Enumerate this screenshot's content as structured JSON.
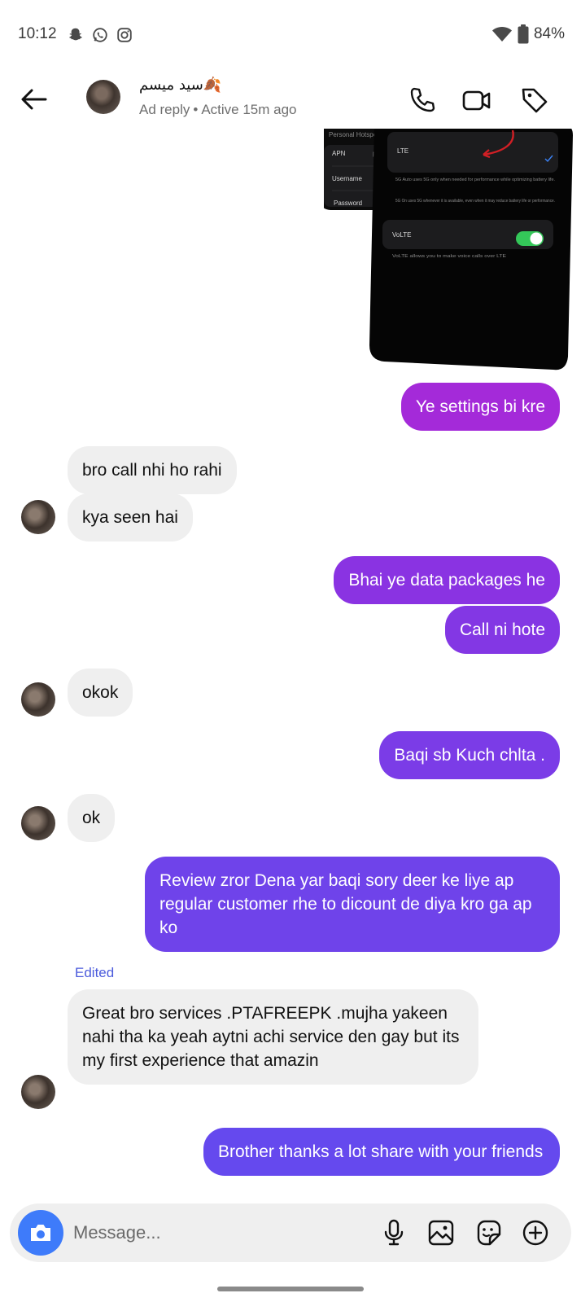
{
  "status_bar": {
    "time": "10:12",
    "battery": "84%",
    "left_icons": [
      "snapchat-icon",
      "whatsapp-icon",
      "instagram-icon"
    ],
    "right_icons": [
      "wifi-icon",
      "battery-icon"
    ]
  },
  "header": {
    "contact_name": "سید میسم🍂",
    "ad_reply": "Ad reply",
    "separator": "•",
    "active_status": "Active 15m ago",
    "icons": [
      "back-arrow-icon",
      "phone-icon",
      "video-icon",
      "tag-icon"
    ]
  },
  "shared_image": {
    "left_card_rows": [
      "Personal Hotspo",
      "APN",
      "Username",
      "Password"
    ],
    "lte_label": "LTE",
    "note_1": "5G Auto uses 5G only when needed for performance while optimizing battery life.",
    "note_2": "5G On uses 5G whenever it is available, even when it may reduce battery life or performance.",
    "volte_label": "VoLTE",
    "volte_note": "VoLTE allows you to make voice calls over LTE"
  },
  "messages": [
    {
      "from": "me",
      "text": "Ye settings bi kre",
      "color": "#a42ad9"
    },
    {
      "from": "them",
      "text": "bro call nhi ho rahi"
    },
    {
      "from": "them",
      "text": "kya seen hai"
    },
    {
      "from": "me",
      "text": "Bhai ye data packages he",
      "color": "#8a33e2"
    },
    {
      "from": "me",
      "text": "Call ni hote",
      "color": "#8337e4"
    },
    {
      "from": "them",
      "text": "okok"
    },
    {
      "from": "me",
      "text": "Baqi sb Kuch chlta .",
      "color": "#7b3ce7"
    },
    {
      "from": "them",
      "text": "ok"
    },
    {
      "from": "me",
      "text": "Review zror Dena yar baqi sory deer ke liye ap regular customer rhe to dicount de diya kro ga ap ko",
      "color": "#6f43ea"
    },
    {
      "from": "them",
      "text": "Great bro services .PTAFREEPK .mujha yakeen nahi tha ka yeah aytni achi service den gay but its my first experience that amazin",
      "edited_label": "Edited"
    },
    {
      "from": "me",
      "text": "Brother thanks a lot share with your friends",
      "color": "#6549ee"
    }
  ],
  "composer": {
    "placeholder": "Message...",
    "icons": [
      "camera-icon",
      "microphone-icon",
      "gallery-icon",
      "sticker-icon",
      "plus-icon"
    ]
  }
}
